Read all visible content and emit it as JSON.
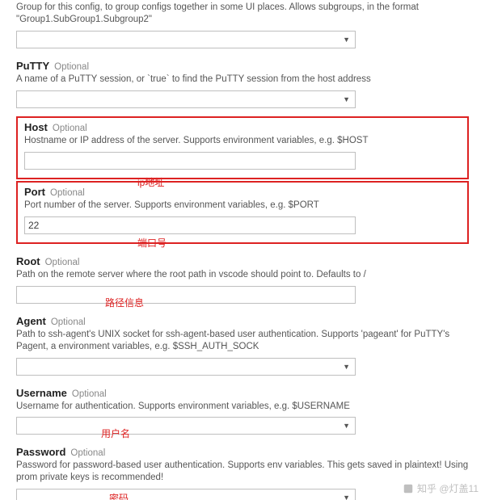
{
  "top_desc": "Group for this config, to group configs together in some UI places. Allows subgroups, in the format \"Group1.SubGroup1.Subgroup2\"",
  "optional_text": "Optional",
  "putty": {
    "label": "PuTTY",
    "desc": "A name of a PuTTY session, or `true` to find the PuTTY session from the host address"
  },
  "host": {
    "label": "Host",
    "desc": "Hostname or IP address of the server. Supports environment variables, e.g. $HOST",
    "value": "",
    "annotation": "ip地址"
  },
  "port": {
    "label": "Port",
    "desc": "Port number of the server. Supports environment variables, e.g. $PORT",
    "value": "22",
    "annotation": "端口号"
  },
  "root": {
    "label": "Root",
    "desc": "Path on the remote server where the root path in vscode should point to. Defaults to /",
    "value": "",
    "annotation": "路径信息"
  },
  "agent": {
    "label": "Agent",
    "desc": "Path to ssh-agent's UNIX socket for ssh-agent-based user authentication. Supports 'pageant' for PuTTY's Pagent, a environment variables, e.g. $SSH_AUTH_SOCK"
  },
  "username": {
    "label": "Username",
    "desc": "Username for authentication. Supports environment variables, e.g. $USERNAME",
    "annotation": "用户名"
  },
  "password": {
    "label": "Password",
    "desc": "Password for password-based user authentication. Supports env variables. This gets saved in plaintext! Using prom private keys is recommended!",
    "annotation": "密码"
  },
  "watermark": "知乎 @灯盖11"
}
